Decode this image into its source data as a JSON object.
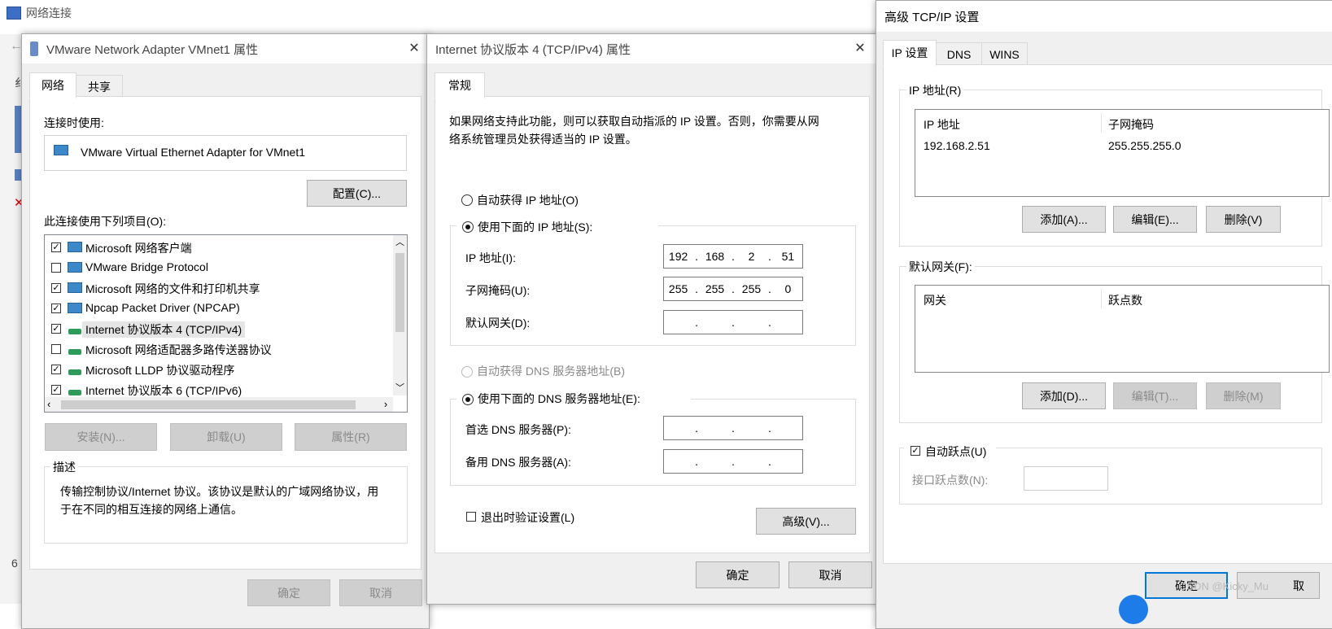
{
  "background_window": {
    "title": "网络连接",
    "partial_chars": [
      "纟",
      "6"
    ]
  },
  "adapter_dialog": {
    "title": "VMware Network Adapter VMnet1 属性",
    "tabs": [
      "网络",
      "共享"
    ],
    "connect_using_label": "连接时使用:",
    "adapter_name": "VMware Virtual Ethernet Adapter for VMnet1",
    "configure_button": "配置(C)...",
    "items_label": "此连接使用下列项目(O):",
    "items": [
      {
        "label": "Microsoft 网络客户端",
        "checked": true,
        "icon": "network-client-icon"
      },
      {
        "label": "VMware Bridge Protocol",
        "checked": false,
        "icon": "network-client-icon"
      },
      {
        "label": "Microsoft 网络的文件和打印机共享",
        "checked": true,
        "icon": "network-client-icon"
      },
      {
        "label": "Npcap Packet Driver (NPCAP)",
        "checked": true,
        "icon": "network-client-icon"
      },
      {
        "label": "Internet 协议版本 4 (TCP/IPv4)",
        "checked": true,
        "icon": "protocol-icon",
        "selected": true
      },
      {
        "label": "Microsoft 网络适配器多路传送器协议",
        "checked": false,
        "icon": "protocol-icon"
      },
      {
        "label": "Microsoft LLDP 协议驱动程序",
        "checked": true,
        "icon": "protocol-icon"
      },
      {
        "label": "Internet 协议版本 6 (TCP/IPv6)",
        "checked": true,
        "icon": "protocol-icon"
      }
    ],
    "install_button": "安装(N)...",
    "uninstall_button": "卸载(U)",
    "properties_button": "属性(R)",
    "description_title": "描述",
    "description_text_line1": "传输控制协议/Internet 协议。该协议是默认的广域网络协议，用",
    "description_text_line2": "于在不同的相互连接的网络上通信。",
    "ok_button": "确定",
    "cancel_button": "取消"
  },
  "ipv4_dialog": {
    "title": "Internet 协议版本 4 (TCP/IPv4) 属性",
    "tab": "常规",
    "intro_line1": "如果网络支持此功能，则可以获取自动指派的 IP 设置。否则，你需要从网",
    "intro_line2": "络系统管理员处获得适当的 IP 设置。",
    "auto_ip_label": "自动获得 IP 地址(O)",
    "manual_ip_label": "使用下面的 IP 地址(S):",
    "ip_address_label": "IP 地址(I):",
    "ip_address": [
      "192",
      "168",
      "2",
      "51"
    ],
    "subnet_mask_label": "子网掩码(U):",
    "subnet_mask": [
      "255",
      "255",
      "255",
      "0"
    ],
    "gateway_label": "默认网关(D):",
    "gateway": [
      "",
      "",
      "",
      ""
    ],
    "auto_dns_label": "自动获得 DNS 服务器地址(B)",
    "manual_dns_label": "使用下面的 DNS 服务器地址(E):",
    "preferred_dns_label": "首选 DNS 服务器(P):",
    "preferred_dns": [
      "",
      "",
      "",
      ""
    ],
    "alternate_dns_label": "备用 DNS 服务器(A):",
    "alternate_dns": [
      "",
      "",
      "",
      ""
    ],
    "validate_on_exit_label": "退出时验证设置(L)",
    "advanced_button": "高级(V)...",
    "ok_button": "确定",
    "cancel_button": "取消"
  },
  "advanced_dialog": {
    "title": "高级 TCP/IP 设置",
    "tabs": [
      "IP 设置",
      "DNS",
      "WINS"
    ],
    "ip_group_title": "IP 地址(R)",
    "ip_table_headers": [
      "IP 地址",
      "子网掩码"
    ],
    "ip_table_rows": [
      [
        "192.168.2.51",
        "255.255.255.0"
      ]
    ],
    "ip_add_button": "添加(A)...",
    "ip_edit_button": "编辑(E)...",
    "ip_delete_button": "删除(V)",
    "gateway_group_title": "默认网关(F):",
    "gateway_table_headers": [
      "网关",
      "跃点数"
    ],
    "gw_add_button": "添加(D)...",
    "gw_edit_button": "编辑(T)...",
    "gw_delete_button": "删除(M)",
    "auto_metric_label": "自动跃点(U)",
    "interface_metric_label": "接口跃点数(N):",
    "ok_button": "确定",
    "cancel_button_partial": "取",
    "watermark": "CSDN @Kicky_Mu"
  }
}
